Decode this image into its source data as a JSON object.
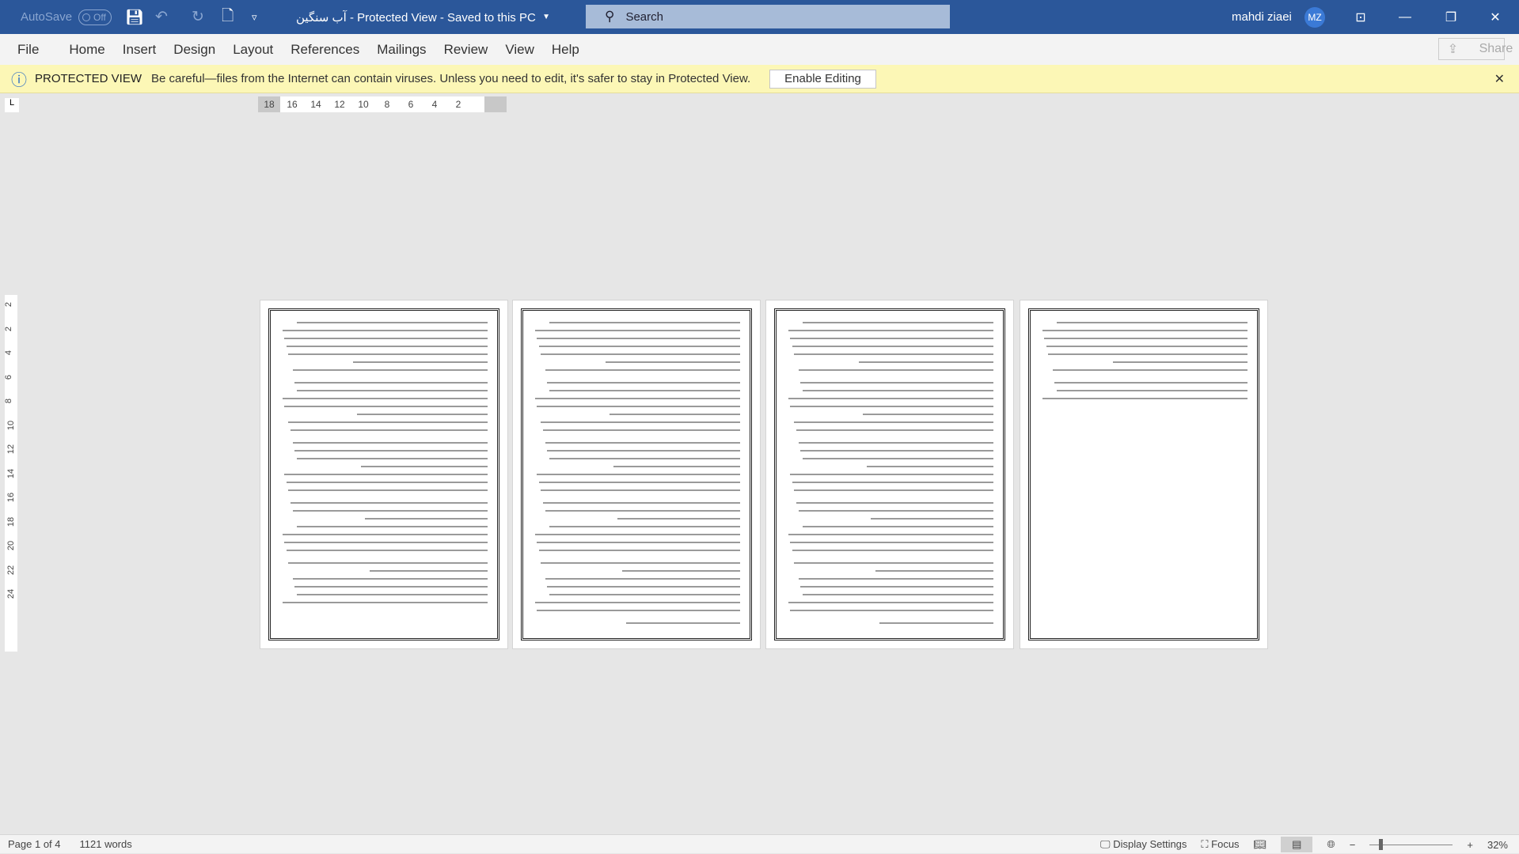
{
  "titlebar": {
    "autosave": "AutoSave",
    "autosave_state": "Off",
    "doc_title": "آب سنگین  -  Protected View  -  Saved to this PC",
    "search_placeholder": "Search",
    "user": "mahdi ziaei",
    "avatar": "MZ"
  },
  "menu": [
    "File",
    "Home",
    "Insert",
    "Design",
    "Layout",
    "References",
    "Mailings",
    "Review",
    "View",
    "Help"
  ],
  "share": "Share",
  "protected_view": {
    "title": "PROTECTED VIEW",
    "message": "Be careful—files from the Internet can contain viruses. Unless you need to edit, it's safer to stay in Protected View.",
    "button": "Enable Editing"
  },
  "ruler": {
    "h": [
      "18",
      "16",
      "14",
      "12",
      "10",
      "8",
      "6",
      "4",
      "2"
    ],
    "v": [
      "2",
      "2",
      "4",
      "6",
      "8",
      "10",
      "12",
      "14",
      "16",
      "18",
      "20",
      "22",
      "24"
    ]
  },
  "status": {
    "page": "Page 1 of 4",
    "words": "1121 words",
    "display_settings": "Display Settings",
    "focus": "Focus",
    "zoom": "32%"
  },
  "colors": {
    "titlebar": "#2b579a",
    "protected_bar": "#fcf7b6"
  }
}
